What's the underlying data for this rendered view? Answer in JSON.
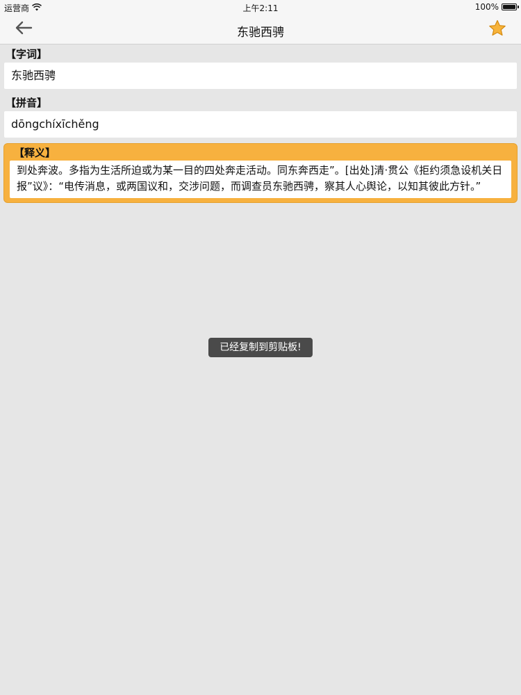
{
  "status_bar": {
    "carrier": "运营商",
    "time": "上午2:11",
    "battery": "100%",
    "battery_level": 1.0
  },
  "nav": {
    "title": "东驰西骋",
    "back_icon": "arrow-left-icon",
    "favorite_icon": "star-icon",
    "star_color": "#f5a623"
  },
  "word": {
    "label": "【字词】",
    "value": "东驰西骋"
  },
  "pinyin": {
    "label": "【拼音】",
    "value": "dōngchíxīchěng"
  },
  "meaning": {
    "label": "【释义】",
    "value": "到处奔波。多指为生活所迫或为某一目的四处奔走活动。同东奔西走”。[出处]清·贯公《拒约须急设机关日报”议》：“电传消息，或两国议和，交涉问题，而调查员东驰西骋，察其人心舆论，以知其彼此方针。”",
    "card_color": "#f7b13f"
  },
  "toast": {
    "message": "已经复制到剪贴板!"
  }
}
